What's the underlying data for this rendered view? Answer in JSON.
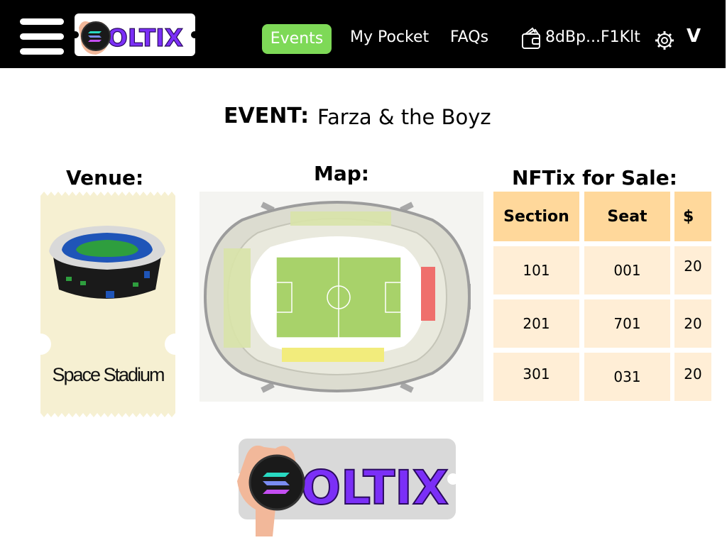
{
  "header": {
    "brand": "OLTIX",
    "nav": {
      "events": "Events",
      "my_pocket": "My Pocket",
      "faqs": "FAQs"
    },
    "wallet_address": "8dBp...F1Klt",
    "menu_chevron": "V"
  },
  "event": {
    "label": "EVENT:",
    "name": "Farza & the Boyz"
  },
  "venue": {
    "heading": "Venue:",
    "name": "Space Stadium"
  },
  "map": {
    "heading": "Map:"
  },
  "nftix": {
    "heading": "NFTix for Sale:",
    "columns": [
      "Section",
      "Seat",
      "$"
    ],
    "rows": [
      {
        "section": "101",
        "seat": "001",
        "price": "20"
      },
      {
        "section": "201",
        "seat": "701",
        "price": "20"
      },
      {
        "section": "301",
        "seat": "031",
        "price": "20"
      }
    ]
  },
  "footer": {
    "brand": "OLTIX"
  },
  "colors": {
    "topbar": "#000000",
    "events_active": "#7ed957",
    "table_header": "#ffd89b",
    "table_cell": "#ffeed6",
    "ticket": "#f6f0d2",
    "logo_text": "#7b2ff7"
  },
  "icons": [
    "hamburger-icon",
    "wallet-icon",
    "gear-icon",
    "chevron-down-icon",
    "solana-coin-icon",
    "stadium-icon"
  ]
}
